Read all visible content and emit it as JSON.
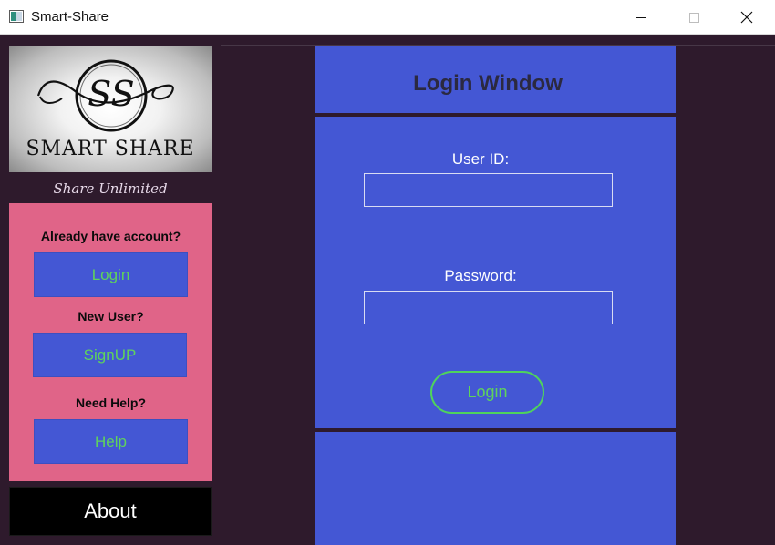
{
  "window": {
    "title": "Smart-Share"
  },
  "sidebar": {
    "logo_text": "SMART SHARE",
    "logo_monogram": "SS",
    "tagline": "Share Unlimited",
    "account_label": "Already have account?",
    "login_label": "Login",
    "new_user_label": "New User?",
    "signup_label": "SignUP",
    "help_prompt": "Need Help?",
    "help_label": "Help",
    "about_label": "About"
  },
  "main": {
    "header_title": "Login Window",
    "user_id_label": "User ID:",
    "user_id_value": "",
    "password_label": "Password:",
    "password_value": "",
    "login_label": "Login"
  },
  "colors": {
    "background": "#2e1a2c",
    "panel_blue": "#4457d4",
    "sidebar_pink": "#e06488",
    "button_text_green": "#5fd35c",
    "about_black": "#000000"
  }
}
